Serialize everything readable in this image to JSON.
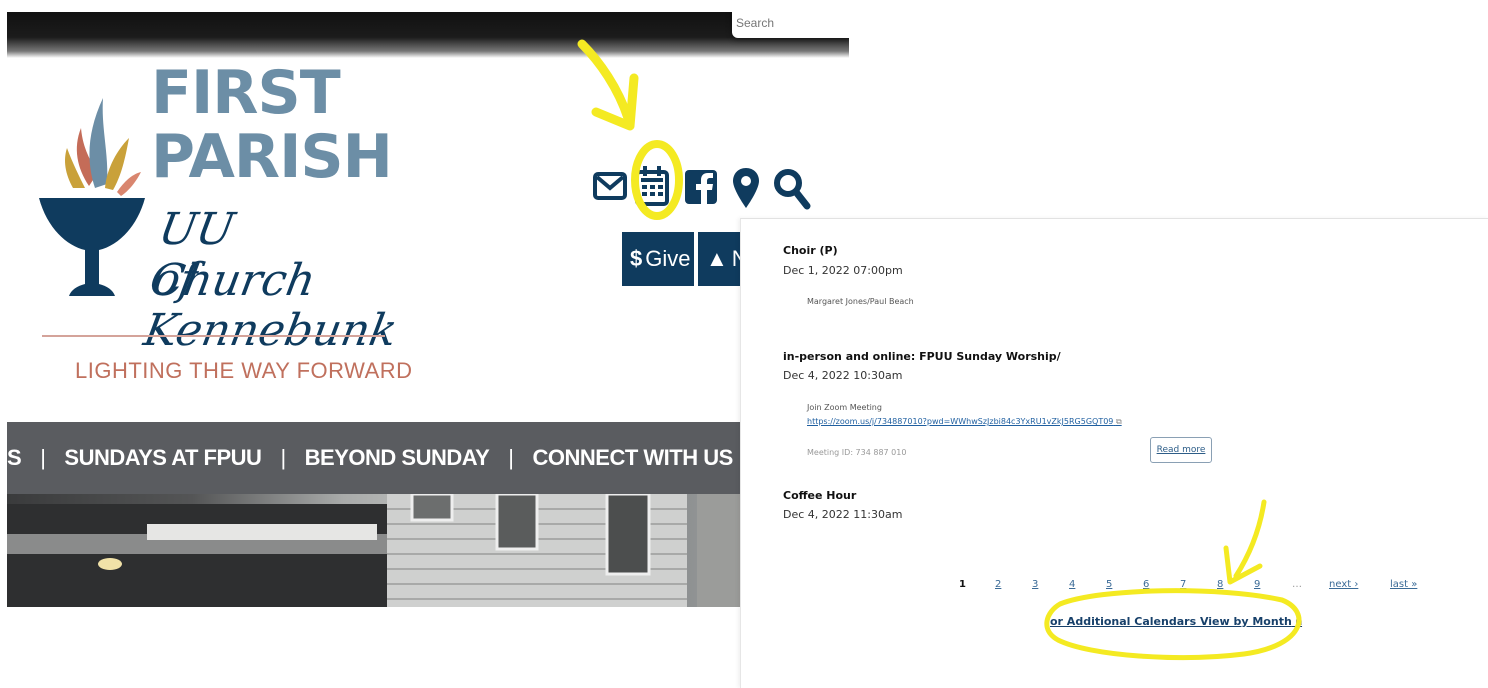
{
  "site": {
    "search_placeholder": "Search",
    "brand": {
      "line1": "FIRST",
      "line2": "PARISH",
      "script1": "UU Church",
      "script2": "of Kennebunk"
    },
    "tagline": "LIGHTING THE WAY FORWARD",
    "icons": [
      "envelope-icon",
      "calendar-icon",
      "facebook-icon",
      "map-pin-icon",
      "search-icon"
    ],
    "give_label": "Give",
    "second_button_label": "N",
    "nav": {
      "partial": "S",
      "items": [
        "SUNDAYS AT FPUU",
        "BEYOND SUNDAY",
        "CONNECT WITH US"
      ],
      "separator": "|"
    }
  },
  "events_panel": {
    "events": [
      {
        "title": "Choir (P)",
        "date": "Dec 1, 2022 07:00pm",
        "body": "Margaret Jones/Paul Beach"
      },
      {
        "title": "in-person and online: FPUU Sunday Worship/",
        "date": "Dec 4, 2022 10:30am",
        "body": "Join Zoom Meeting",
        "link": "https://zoom.us/j/734887010?pwd=WWhwSzJzbi84c3YxRU1vZkJ5RG5GQT09",
        "meeting_id": "Meeting ID: 734 887 010",
        "read_more": "Read more"
      },
      {
        "title": "Coffee Hour",
        "date": "Dec 4, 2022 11:30am"
      }
    ],
    "pager": {
      "pages": [
        "1",
        "2",
        "3",
        "4",
        "5",
        "6",
        "7",
        "8",
        "9"
      ],
      "current": "1",
      "ellipsis": "…",
      "next": "next ›",
      "last": "last »"
    },
    "additional_link": "or Additional Calendars View by Month"
  },
  "colors": {
    "navy": "#0f3b5e",
    "slate_blue": "#6c8ea6",
    "terracotta": "#c0705d",
    "nav_gray": "#5a5c60",
    "highlight_yellow": "#f4ea22"
  }
}
